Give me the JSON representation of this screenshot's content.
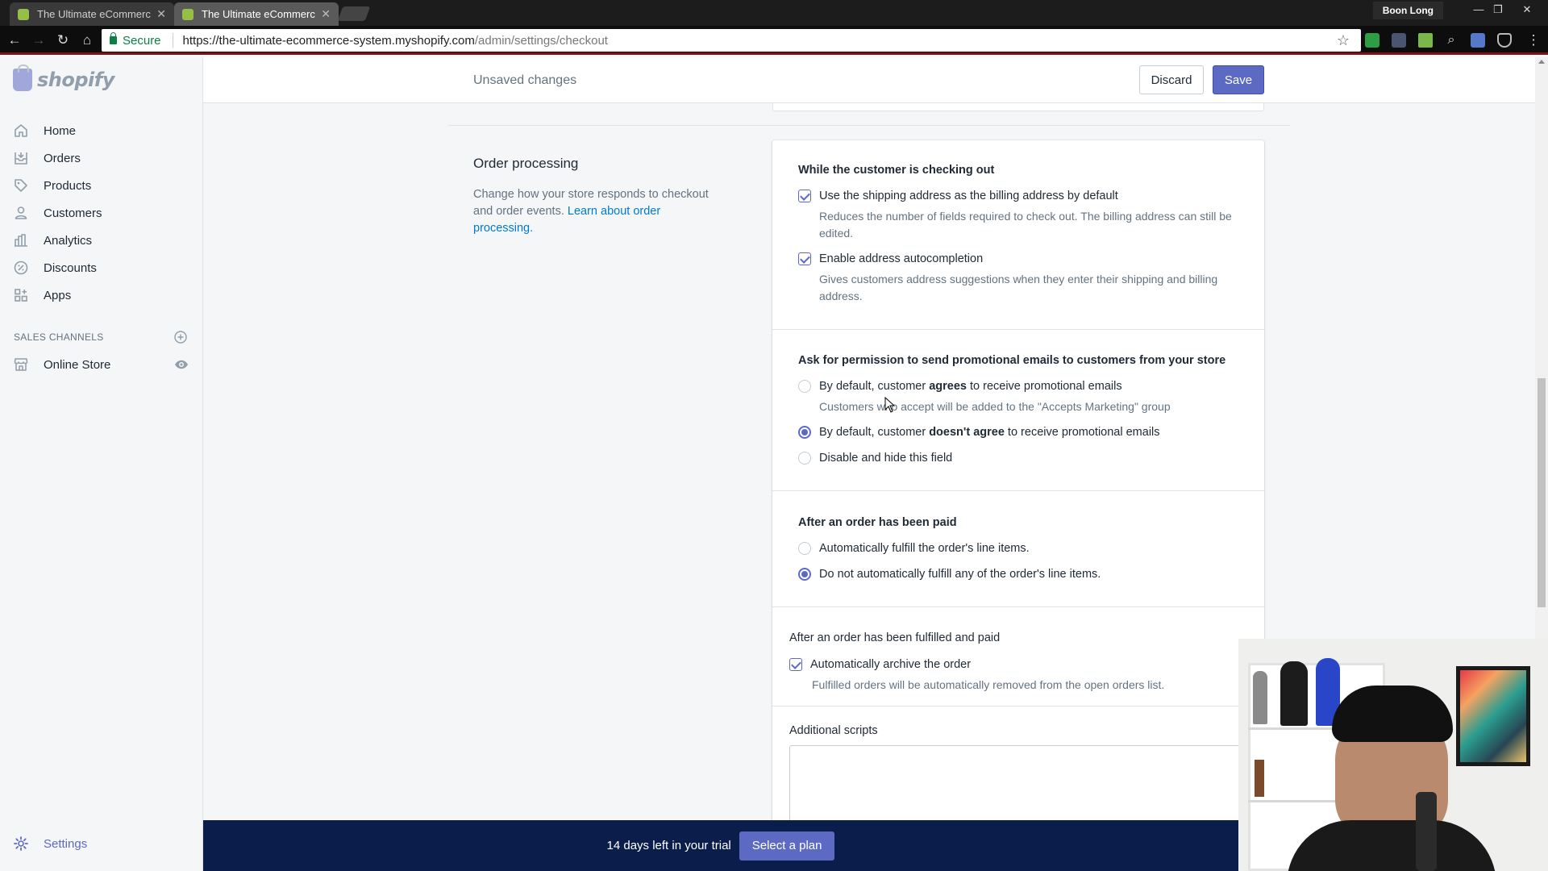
{
  "browser": {
    "tabs": [
      {
        "label": "The Ultimate eCommerc",
        "active": false
      },
      {
        "label": "The Ultimate eCommerc",
        "active": true
      }
    ],
    "profile": "Boon Long",
    "secure_label": "Secure",
    "url_host": "https://the-ultimate-ecommerce-system.myshopify.com",
    "url_path": "/admin/settings/checkout"
  },
  "sidebar": {
    "logo_text": "shopify",
    "items": [
      {
        "label": "Home",
        "icon": "home-icon"
      },
      {
        "label": "Orders",
        "icon": "orders-icon"
      },
      {
        "label": "Products",
        "icon": "tag-icon"
      },
      {
        "label": "Customers",
        "icon": "person-icon"
      },
      {
        "label": "Analytics",
        "icon": "bar-chart-icon"
      },
      {
        "label": "Discounts",
        "icon": "discount-icon"
      },
      {
        "label": "Apps",
        "icon": "apps-icon"
      }
    ],
    "sales_channels_label": "SALES CHANNELS",
    "online_store_label": "Online Store",
    "settings_label": "Settings"
  },
  "topbar": {
    "unsaved": "Unsaved changes",
    "discard": "Discard",
    "save": "Save"
  },
  "section": {
    "title": "Order processing",
    "desc": "Change how your store responds to checkout and order events.",
    "link": "Learn about order processing."
  },
  "checkout": {
    "heading": "While the customer is checking out",
    "opt1": "Use the shipping address as the billing address by default",
    "opt1_help": "Reduces the number of fields required to check out. The billing address can still be edited.",
    "opt2": "Enable address autocompletion",
    "opt2_help": "Gives customers address suggestions when they enter their shipping and billing address."
  },
  "promo": {
    "heading": "Ask for permission to send promotional emails to customers from your store",
    "r1_pre": "By default, customer ",
    "r1_bold": "agrees",
    "r1_post": " to receive promotional emails",
    "r1_help": "Customers who accept will be added to the \"Accepts Marketing\" group",
    "r2_pre": "By default, customer ",
    "r2_bold": "doesn't agree",
    "r2_post": " to receive promotional emails",
    "r3": "Disable and hide this field",
    "selected": 2
  },
  "paid": {
    "heading": "After an order has been paid",
    "r1": "Automatically fulfill the order's line items.",
    "r2": "Do not automatically fulfill any of the order's line items.",
    "selected": 2
  },
  "fulfilled": {
    "heading": "After an order has been fulfilled and paid",
    "opt": "Automatically archive the order",
    "help": "Fulfilled orders will be automatically removed from the open orders list."
  },
  "scripts": {
    "label": "Additional scripts"
  },
  "trial": {
    "text": "14 days left in your trial",
    "button": "Select a plan"
  },
  "colors": {
    "accent": "#5c6ac4",
    "banner": "#0b1d4a",
    "link": "#007ace"
  }
}
